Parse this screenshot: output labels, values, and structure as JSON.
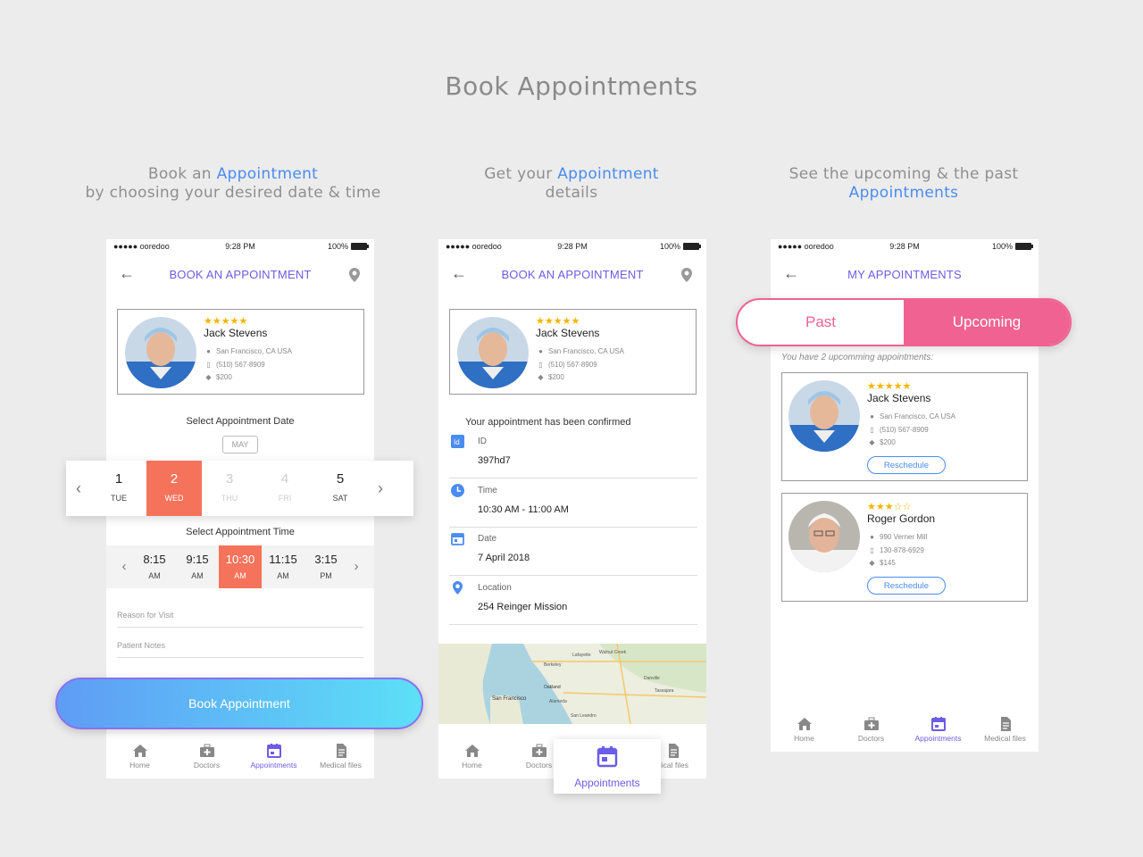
{
  "title": "Book Appointments",
  "captions": [
    {
      "pre": "Book an ",
      "hl": "Appointment",
      "line2": "by choosing your desired date & time"
    },
    {
      "pre": "Get your ",
      "hl": "Appointment",
      "line2": "details"
    },
    {
      "line1": "See the upcoming & the past",
      "hl": "Appointments"
    }
  ],
  "status": {
    "carrier": "●●●●● ooredoo",
    "time": "9:28 PM",
    "battery": "100%"
  },
  "screen1": {
    "nav_title": "BOOK AN APPOINTMENT",
    "date_label": "Select Appointment Date",
    "month": "MAY",
    "dates": [
      {
        "num": "1",
        "day": "TUE"
      },
      {
        "num": "2",
        "day": "WED"
      },
      {
        "num": "3",
        "day": "THU"
      },
      {
        "num": "4",
        "day": "FRI"
      },
      {
        "num": "5",
        "day": "SAT"
      }
    ],
    "time_label": "Select Appointment Time",
    "times": [
      {
        "t": "8:15",
        "p": "AM"
      },
      {
        "t": "9:15",
        "p": "AM"
      },
      {
        "t": "10:30",
        "p": "AM"
      },
      {
        "t": "11:15",
        "p": "AM"
      },
      {
        "t": "3:15",
        "p": "PM"
      }
    ],
    "reason_placeholder": "Reason for Visit",
    "notes_placeholder": "Patient Notes",
    "book_button": "Book Appointment"
  },
  "doctor1": {
    "stars": "★★★★★",
    "name": "Jack Stevens",
    "location": "San Francisco, CA USA",
    "phone": "(510) 567-8909",
    "price": "$200"
  },
  "doctor2": {
    "stars": "★★★☆☆",
    "name": "Roger Gordon",
    "location": "990 Verner Mill",
    "phone": "130-878-6929",
    "price": "$145"
  },
  "screen2": {
    "nav_title": "BOOK AN APPOINTMENT",
    "confirmed": "Your appointment has been confirmed",
    "details": [
      {
        "label": "ID",
        "value": "397hd7"
      },
      {
        "label": "Time",
        "value": "10:30 AM - 11:00 AM"
      },
      {
        "label": "Date",
        "value": "7 April 2018"
      },
      {
        "label": "Location",
        "value": "254 Reinger Mission"
      }
    ],
    "map_labels": [
      "San Francisco",
      "Berkeley",
      "Oakland",
      "Alameda",
      "San Leandro",
      "Walnut Creek",
      "Lafayette",
      "Danville",
      "Tassajara"
    ],
    "appointments_popup": "Appointments",
    "doctors_partial": "Doctors",
    "medical_partial": "dical files"
  },
  "screen3": {
    "nav_title": "MY APPOINTMENTS",
    "past": "Past",
    "upcoming": "Upcoming",
    "count_text": "You have 2 upcomming appointments:",
    "reschedule": "Reschedule"
  },
  "tabs": {
    "home": "Home",
    "doctors": "Doctors",
    "appointments": "Appointments",
    "medical": "Medical files"
  },
  "colors": {
    "accent": "#6c5ce7",
    "coral": "#f6735b",
    "pink": "#f06292",
    "blue": "#4a8cf0"
  }
}
